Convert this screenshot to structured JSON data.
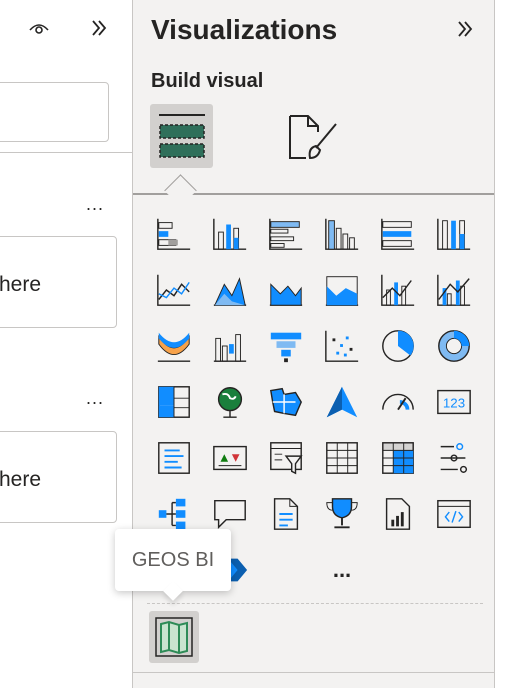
{
  "left_panel": {
    "well1_placeholder": "here",
    "well2_placeholder": "here",
    "more_label": "..."
  },
  "visualizations": {
    "title": "Visualizations",
    "subtitle": "Build visual",
    "more_visuals_label": "...",
    "tooltip": "GEOS BI",
    "icons": [
      "stacked-bar-chart-icon",
      "stacked-column-chart-icon",
      "clustered-bar-chart-icon",
      "clustered-column-chart-icon",
      "100-stacked-bar-chart-icon",
      "100-stacked-column-chart-icon",
      "line-chart-icon",
      "area-chart-icon",
      "stacked-area-chart-icon",
      "100-stacked-area-chart-icon",
      "line-and-stacked-column-chart-icon",
      "line-and-clustered-column-chart-icon",
      "ribbon-chart-icon",
      "waterfall-chart-icon",
      "funnel-icon",
      "scatter-chart-icon",
      "pie-chart-icon",
      "donut-chart-icon",
      "treemap-icon",
      "map-icon",
      "filled-map-icon",
      "azure-map-icon",
      "gauge-icon",
      "card-icon",
      "multi-row-card-icon",
      "kpi-icon",
      "slicer-icon",
      "table-icon",
      "matrix-icon",
      "decomposition-tree-line-icon",
      "key-influencers-icon",
      "qa-icon",
      "smart-narrative-icon",
      "goals-icon",
      "paginated-report-icon",
      "html-content-icon",
      "power-apps-icon",
      "power-automate-icon"
    ]
  },
  "colors": {
    "accent": "#118dff",
    "panel_bg": "#f3f2f1",
    "custom_green": "#2e8b57"
  }
}
